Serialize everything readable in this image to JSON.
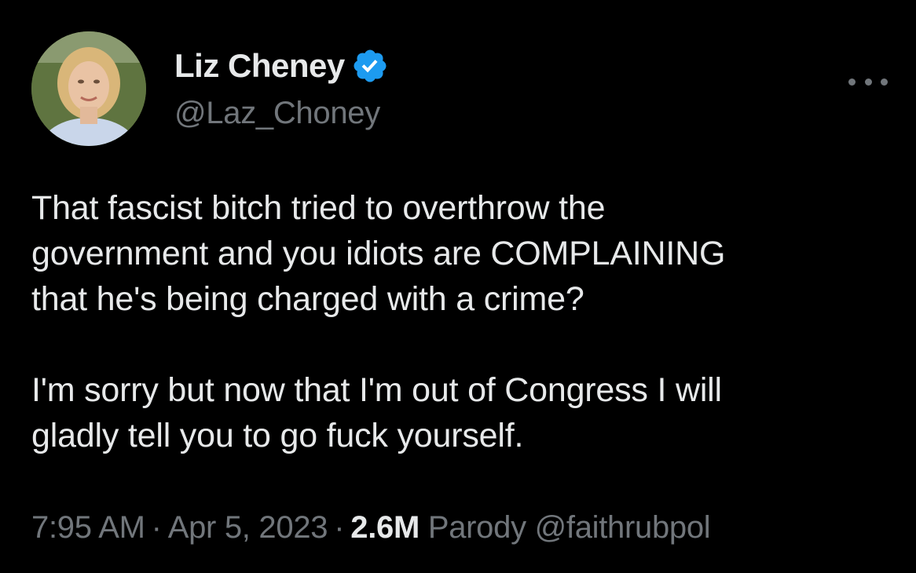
{
  "author": {
    "display_name": "Liz Cheney",
    "handle": "@Laz_Choney",
    "verified": true
  },
  "icons": {
    "avatar": "profile-photo",
    "verified": "verified-badge-icon",
    "more": "more-options-icon"
  },
  "colors": {
    "background": "#000000",
    "primary_text": "#e7e9ea",
    "secondary_text": "#71767b",
    "verified_blue": "#1d9bf0"
  },
  "tweet": {
    "paragraphs": [
      "That fascist bitch tried to overthrow the\ngovernment and you idiots are COMPLAINING\nthat he's being charged with a crime?",
      "I'm sorry but now that I'm out of Congress I will\ngladly tell you to go fuck yourself."
    ]
  },
  "meta": {
    "time": "7:95 AM",
    "separator": "·",
    "date": "Apr 5, 2023",
    "views": "2.6M",
    "views_suffix": "Parody @faithrubpol"
  }
}
